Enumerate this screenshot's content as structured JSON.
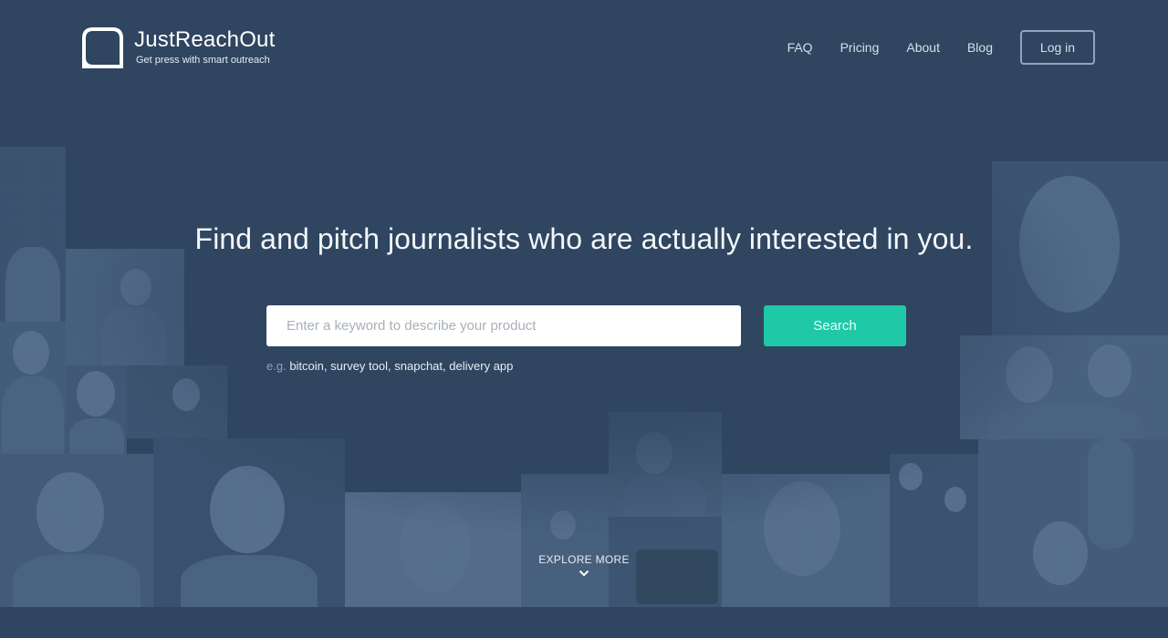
{
  "brand": {
    "name": "JustReachOut",
    "tagline": "Get press with smart outreach"
  },
  "nav": {
    "items": [
      "FAQ",
      "Pricing",
      "About",
      "Blog"
    ],
    "login": "Log in"
  },
  "hero": {
    "title": "Find and pitch journalists who are actually interested in you.",
    "search_placeholder": "Enter a keyword to describe your product",
    "search_button": "Search",
    "examples_prefix": "e.g.",
    "examples": [
      "bitcoin",
      "survey tool",
      "snapchat",
      "delivery app"
    ]
  },
  "explore": {
    "label": "EXPLORE MORE",
    "icon": "chevron-down-icon"
  },
  "colors": {
    "background": "#2f4560",
    "accent": "#1fc9a8",
    "photo_tint": "#425b78"
  }
}
